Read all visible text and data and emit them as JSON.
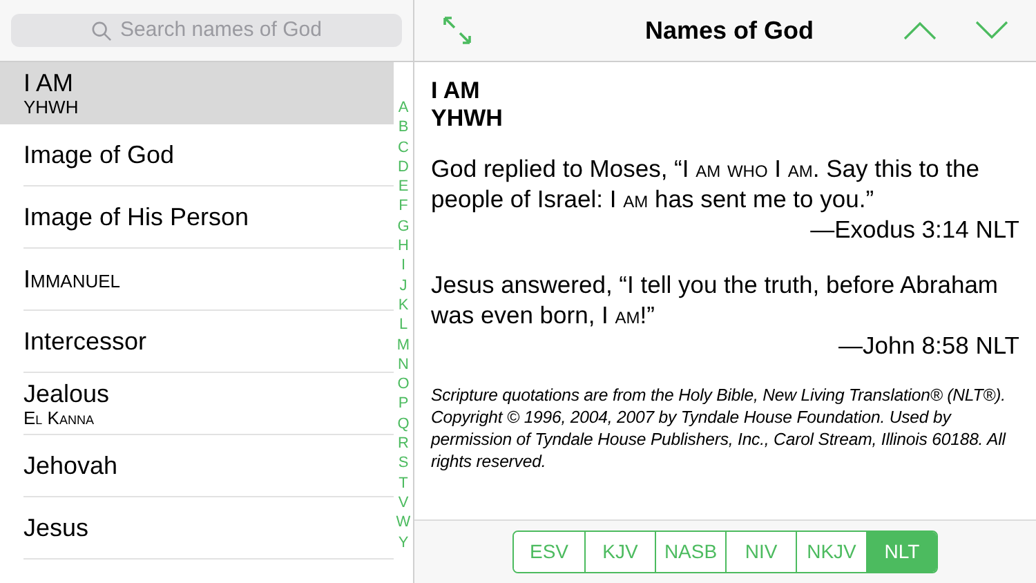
{
  "search": {
    "placeholder": "Search names of God"
  },
  "names": [
    {
      "title": "I AM",
      "subtitle": "YHWH",
      "subtitle_small_caps": false,
      "title_small_caps": false,
      "selected": true
    },
    {
      "title": "Image of God",
      "title_small_caps": false,
      "selected": false
    },
    {
      "title": "Image of His Person",
      "title_small_caps": false,
      "selected": false
    },
    {
      "title": "Immanuel",
      "title_small_caps": true,
      "selected": false
    },
    {
      "title": "Intercessor",
      "title_small_caps": false,
      "selected": false
    },
    {
      "title": "Jealous",
      "subtitle": "El Kanna",
      "subtitle_small_caps": true,
      "title_small_caps": false,
      "selected": false
    },
    {
      "title": "Jehovah",
      "title_small_caps": false,
      "selected": false
    },
    {
      "title": "Jesus",
      "title_small_caps": false,
      "selected": false
    }
  ],
  "index_letters": [
    "A",
    "B",
    "C",
    "D",
    "E",
    "F",
    "G",
    "H",
    "I",
    "J",
    "K",
    "L",
    "M",
    "N",
    "O",
    "P",
    "Q",
    "R",
    "S",
    "T",
    "V",
    "W",
    "Y"
  ],
  "detail": {
    "title": "Names of God",
    "heading": "I AM",
    "subheading": "YHWH",
    "verses": [
      {
        "segments": [
          {
            "text": "God replied to Moses, “",
            "small_caps": false
          },
          {
            "text": "I am who I am",
            "small_caps": true
          },
          {
            "text": ". Say this to the people of Israel: ",
            "small_caps": false
          },
          {
            "text": "I am",
            "small_caps": true
          },
          {
            "text": " has sent me to you.”",
            "small_caps": false
          }
        ],
        "reference": "—Exodus 3:14 NLT"
      },
      {
        "segments": [
          {
            "text": "Jesus answered, “I tell you the truth, before Abraham was even born, ",
            "small_caps": false
          },
          {
            "text": "I am",
            "small_caps": true
          },
          {
            "text": "!”",
            "small_caps": false
          }
        ],
        "reference": "—John 8:58 NLT"
      }
    ],
    "copyright": "Scripture quotations are from the Holy Bible, New Living Translation® (NLT®). Copyright © 1996, 2004, 2007 by Tyndale House Foundation. Used by permission of Tyndale House Publishers, Inc., Carol Stream, Illinois 60188. All rights reserved.",
    "translations": [
      {
        "label": "ESV",
        "selected": false
      },
      {
        "label": "KJV",
        "selected": false
      },
      {
        "label": "NASB",
        "selected": false
      },
      {
        "label": "NIV",
        "selected": false
      },
      {
        "label": "NKJV",
        "selected": false
      },
      {
        "label": "NLT",
        "selected": true
      }
    ]
  }
}
